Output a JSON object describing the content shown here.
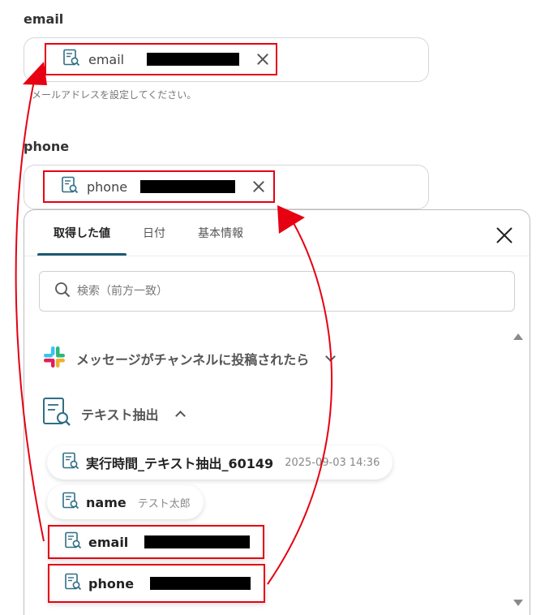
{
  "email_section": {
    "label": "email",
    "chip_label": "email",
    "hint": "メールアドレスを設定してください。"
  },
  "phone_section": {
    "label": "phone",
    "chip_label": "phone"
  },
  "panel": {
    "tabs": [
      {
        "label": "取得した値",
        "active": true
      },
      {
        "label": "日付",
        "active": false
      },
      {
        "label": "基本情報",
        "active": false
      }
    ],
    "search_placeholder": "検索（前方一致）",
    "groups": [
      {
        "label": "メッセージがチャンネルに投稿されたら",
        "icon": "slack-icon",
        "expanded": false
      },
      {
        "label": "テキスト抽出",
        "icon": "document-search-icon",
        "expanded": true
      }
    ],
    "items": [
      {
        "label": "実行時間_テキスト抽出_60149",
        "value": "2025-09-03 14:36"
      },
      {
        "label": "name",
        "value": "テスト太郎"
      },
      {
        "label": "email",
        "value": ""
      },
      {
        "label": "phone",
        "value": ""
      }
    ]
  },
  "colors": {
    "annotation_red": "#e60012",
    "tab_underline": "#1c5a73",
    "icon_teal": "#2e6e86"
  }
}
